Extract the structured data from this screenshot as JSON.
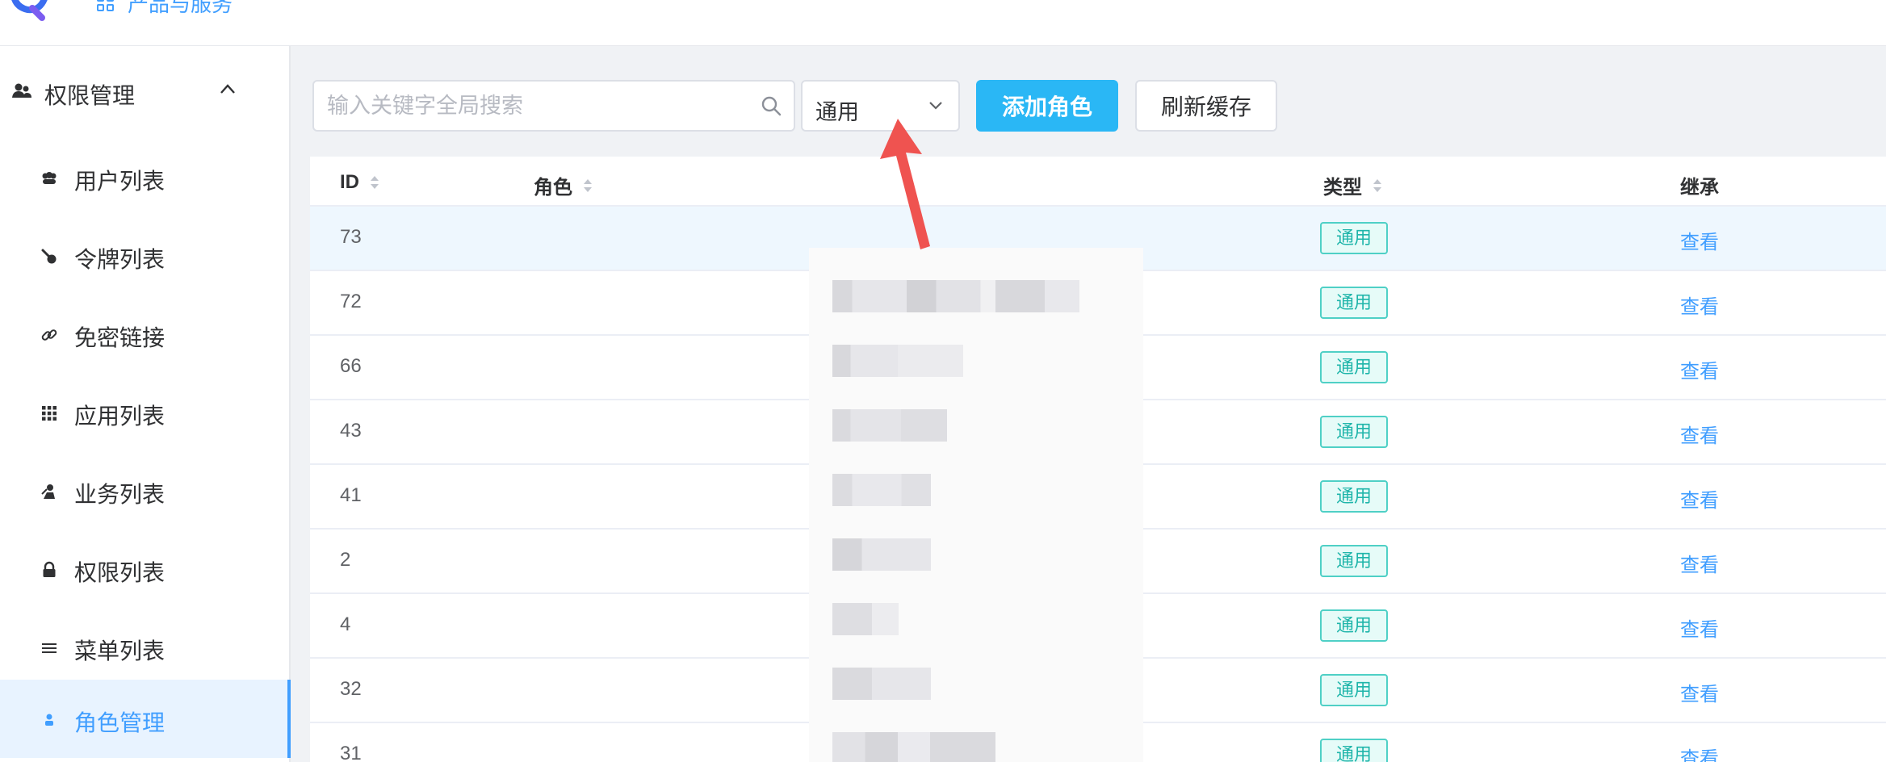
{
  "header": {
    "nav_label": "产品与服务"
  },
  "sidebar": {
    "group": {
      "label": "权限管理",
      "expanded": true
    },
    "items": [
      {
        "label": "用户列表",
        "icon": "users-icon",
        "active": false
      },
      {
        "label": "令牌列表",
        "icon": "token-icon",
        "active": false
      },
      {
        "label": "免密链接",
        "icon": "link-icon",
        "active": false
      },
      {
        "label": "应用列表",
        "icon": "apps-grid-icon",
        "active": false
      },
      {
        "label": "业务列表",
        "icon": "business-icon",
        "active": false
      },
      {
        "label": "权限列表",
        "icon": "lock-icon",
        "active": false
      },
      {
        "label": "菜单列表",
        "icon": "menu-lines-icon",
        "active": false
      },
      {
        "label": "角色管理",
        "icon": "user-icon",
        "active": true
      }
    ]
  },
  "toolbar": {
    "search_placeholder": "输入关键字全局搜索",
    "type_select_value": "通用",
    "add_label": "添加角色",
    "refresh_label": "刷新缓存"
  },
  "table": {
    "columns": {
      "id": "ID",
      "role": "角色",
      "type": "类型",
      "inherit": "继承"
    },
    "rows": [
      {
        "id": "73",
        "type": "通用",
        "action": "查看"
      },
      {
        "id": "72",
        "type": "通用",
        "action": "查看"
      },
      {
        "id": "66",
        "type": "通用",
        "action": "查看"
      },
      {
        "id": "43",
        "type": "通用",
        "action": "查看"
      },
      {
        "id": "41",
        "type": "通用",
        "action": "查看"
      },
      {
        "id": "2",
        "type": "通用",
        "action": "查看"
      },
      {
        "id": "4",
        "type": "通用",
        "action": "查看"
      },
      {
        "id": "32",
        "type": "通用",
        "action": "查看"
      },
      {
        "id": "31",
        "type": "通用",
        "action": "查看"
      }
    ]
  },
  "colors": {
    "primary": "#409eff",
    "add_button": "#2ab7f5",
    "tag_border": "#4fd0c6",
    "tag_text": "#1fb5aa",
    "arrow": "#ef5350"
  }
}
